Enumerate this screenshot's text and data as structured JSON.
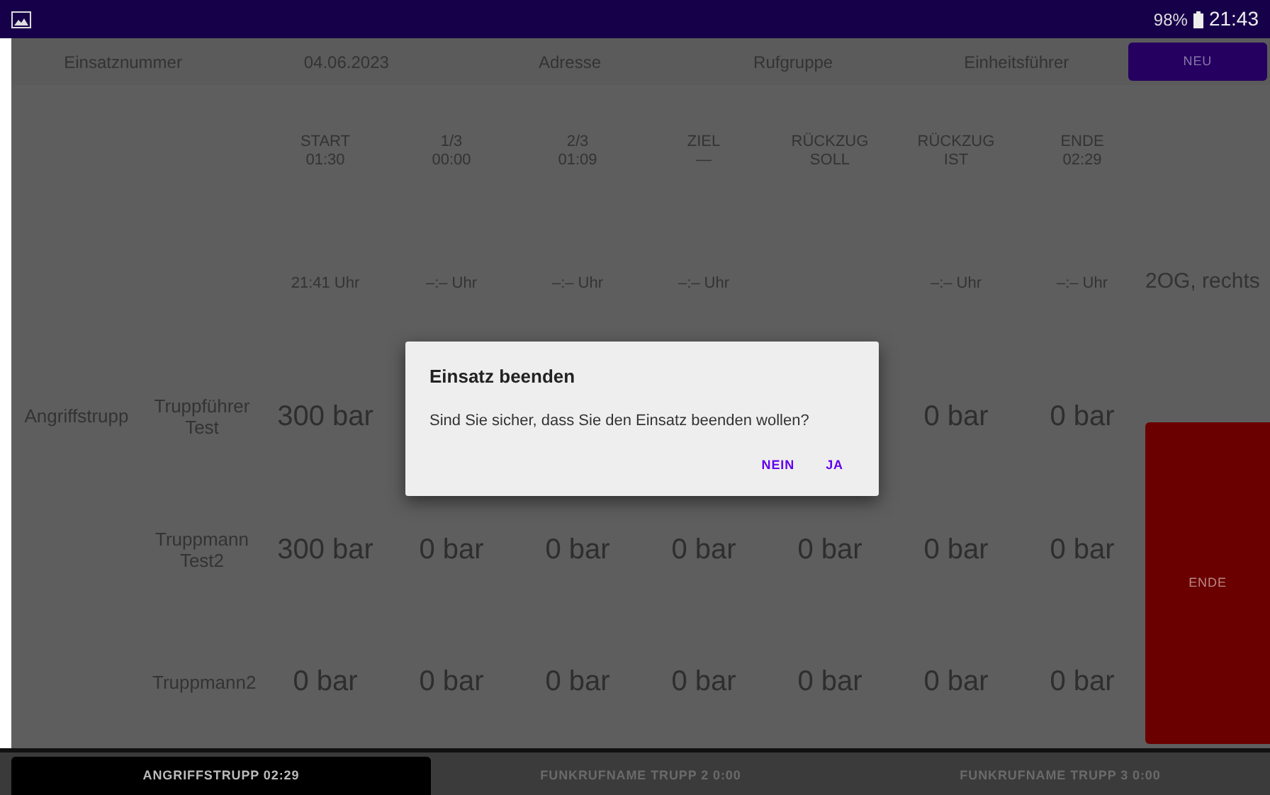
{
  "status_bar": {
    "battery": "98%",
    "time": "21:43"
  },
  "header": {
    "fields": [
      "Einsatznummer",
      "04.06.2023",
      "Adresse",
      "Rufgruppe",
      "Einheitsführer"
    ],
    "new_button": "NEU"
  },
  "columns": [
    {
      "label": "START",
      "time": "01:30",
      "clock": "21:41 Uhr"
    },
    {
      "label": "1/3",
      "time": "00:00",
      "clock": "–:– Uhr"
    },
    {
      "label": "2/3",
      "time": "01:09",
      "clock": "–:– Uhr"
    },
    {
      "label": "ZIEL",
      "time": "—",
      "clock": "–:– Uhr"
    },
    {
      "label": "RÜCKZUG",
      "time": "SOLL"
    },
    {
      "label": "RÜCKZUG",
      "time": "IST",
      "clock": "–:– Uhr"
    },
    {
      "label": "ENDE",
      "time": "02:29",
      "clock": "–:– Uhr"
    }
  ],
  "team": {
    "name": "Angriffstrupp",
    "members": [
      {
        "name": "Truppführer Test",
        "cells": [
          {
            "value": "300 bar"
          },
          {},
          {},
          {},
          {},
          {
            "value": "0 bar"
          },
          {
            "value": "0 bar"
          }
        ]
      },
      {
        "name": "Truppmann Test2",
        "cells": [
          {
            "value": "300 bar"
          },
          {
            "value": "0 bar"
          },
          {
            "value": "0 bar"
          },
          {
            "value": "0 bar"
          },
          {
            "value": "0 bar"
          },
          {
            "value": "0 bar"
          },
          {
            "value": "0 bar"
          }
        ]
      },
      {
        "name": "Truppmann2",
        "cells": [
          {
            "value": "0 bar"
          },
          {
            "value": "0 bar"
          },
          {
            "value": "0 bar"
          },
          {
            "value": "0 bar"
          },
          {
            "value": "0 bar"
          },
          {
            "value": "0 bar"
          },
          {
            "value": "0 bar"
          }
        ]
      }
    ]
  },
  "location": "2OG, rechts",
  "end_button": "ENDE",
  "dialog": {
    "title": "Einsatz beenden",
    "message": "Sind Sie sicher, dass Sie den Einsatz beenden wollen?",
    "buttons": [
      "NEIN",
      "JA"
    ]
  },
  "tabs": [
    {
      "label": "ANGRIFFSTRUPP 02:29",
      "selected": true
    },
    {
      "label": "FUNKRUFNAME TRUPP 2 0:00",
      "selected": false
    },
    {
      "label": "FUNKRUFNAME TRUPP 3 0:00",
      "selected": false
    }
  ]
}
